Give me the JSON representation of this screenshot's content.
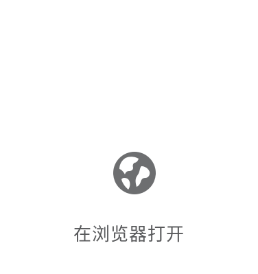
{
  "open_in_browser": {
    "label": "在浏览器打开",
    "icon": "globe-icon",
    "icon_color": "#6d6e70",
    "text_color": "#58595b"
  }
}
